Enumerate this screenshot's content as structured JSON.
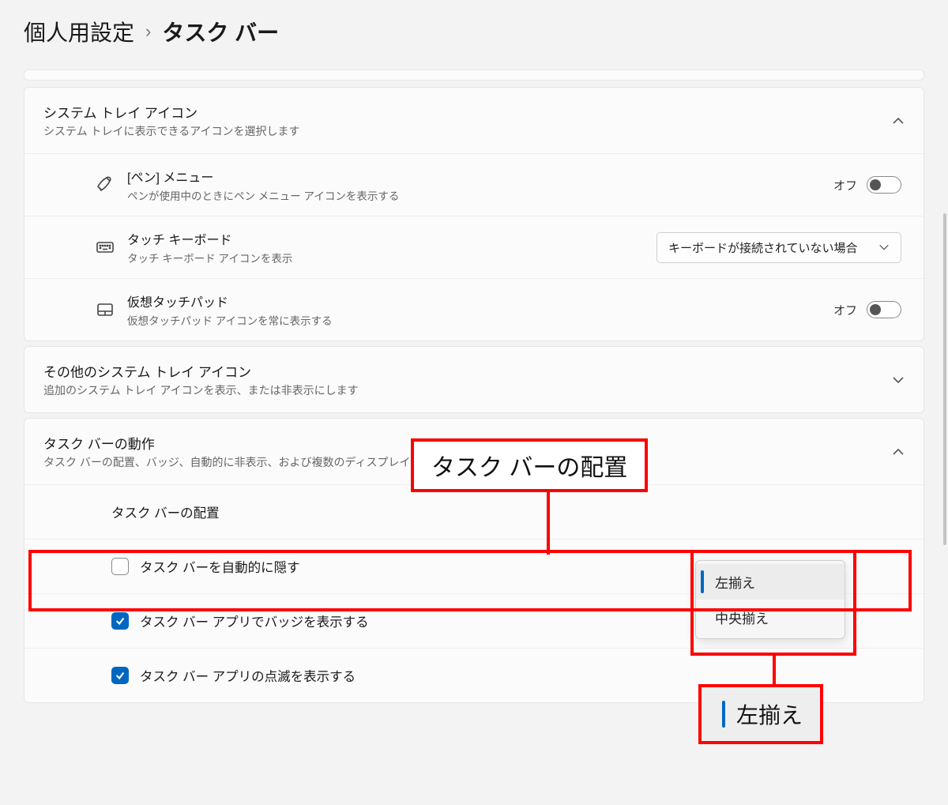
{
  "breadcrumb": {
    "parent": "個人用設定",
    "separator": "›",
    "current": "タスク バー"
  },
  "sections": {
    "system_tray": {
      "title": "システム トレイ アイコン",
      "desc": "システム トレイに表示できるアイコンを選択します",
      "items": {
        "pen": {
          "title": "[ペン] メニュー",
          "desc": "ペンが使用中のときにペン メニュー アイコンを表示する",
          "state_text": "オフ"
        },
        "touch_keyboard": {
          "title": "タッチ キーボード",
          "desc": "タッチ キーボード アイコンを表示",
          "dropdown_value": "キーボードが接続されていない場合"
        },
        "virtual_touchpad": {
          "title": "仮想タッチパッド",
          "desc": "仮想タッチパッド アイコンを常に表示する",
          "state_text": "オフ"
        }
      }
    },
    "other_tray": {
      "title": "その他のシステム トレイ アイコン",
      "desc": "追加のシステム トレイ アイコンを表示、または非表示にします"
    },
    "behaviors": {
      "title": "タスク バーの動作",
      "desc": "タスク バーの配置、バッジ、自動的に非表示、および複数のディスプレイ",
      "alignment": {
        "label": "タスク バーの配置",
        "options": [
          "左揃え",
          "中央揃え"
        ],
        "selected": "左揃え"
      },
      "auto_hide": "タスク バーを自動的に隠す",
      "badges": "タスク バー アプリでバッジを表示する",
      "flash": "タスク バー アプリの点滅を表示する"
    }
  },
  "annotation": {
    "label": "タスク バーの配置",
    "selected_box": "左揃え"
  }
}
